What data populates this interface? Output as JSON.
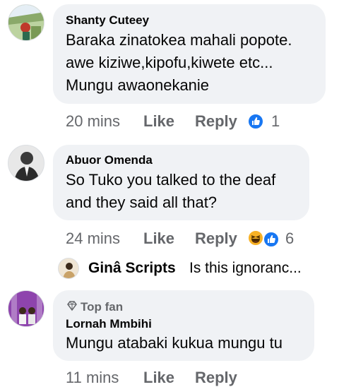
{
  "comments": [
    {
      "author": "Shanty Cuteey",
      "lines": [
        "Baraka zinatokea mahali popote.",
        "awe kiziwe,kipofu,kiwete etc...",
        "Mungu awaonekanie"
      ],
      "time": "20 mins",
      "like_label": "Like",
      "reply_label": "Reply",
      "reaction_icons": [
        "like-icon"
      ],
      "reaction_count": "1"
    },
    {
      "author": "Abuor Omenda",
      "lines": [
        "So Tuko you talked to the deaf",
        "and they said all that?"
      ],
      "time": "24 mins",
      "like_label": "Like",
      "reply_label": "Reply",
      "reaction_icons": [
        "haha-icon",
        "like-icon"
      ],
      "reaction_count": "6"
    },
    {
      "badge": "Top fan",
      "author": "Lornah Mmbihi",
      "lines": [
        "Mungu atabaki kukua mungu tu"
      ],
      "time": "11 mins",
      "like_label": "Like",
      "reply_label": "Reply"
    }
  ],
  "reply_preview": {
    "author": "Ginâ Scripts",
    "text": "Is this ignoranc..."
  },
  "colors": {
    "bubble": "#f0f2f5",
    "meta": "#65676b",
    "like_blue": "#1877f2",
    "haha_yellow": "#f7b125"
  }
}
